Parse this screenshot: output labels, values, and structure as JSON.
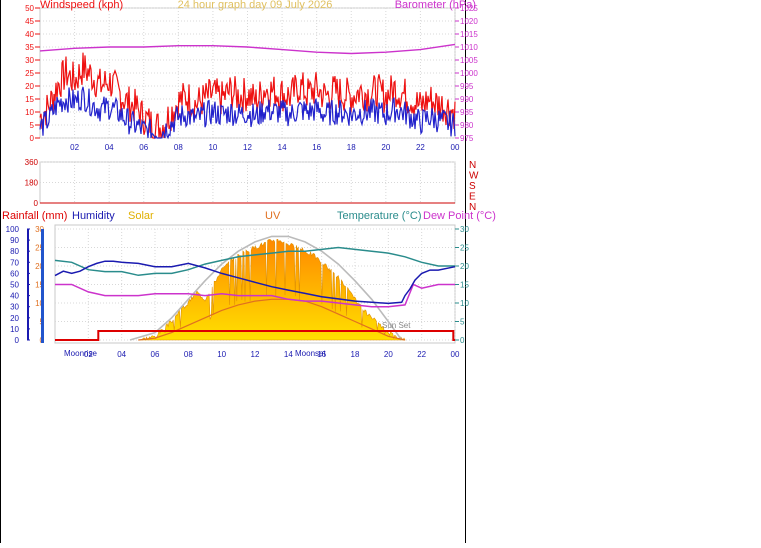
{
  "colors": {
    "wind": "#ee1111",
    "gust_avg": "#2222cc",
    "baro": "#cc33cc",
    "wind_dir_axis": "#cc0000",
    "rain": "#dd0000",
    "humidity": "#1a1ab0",
    "solar": "#e0b000",
    "uv": "#e07020",
    "temperature": "#2a8c8c",
    "dew_point": "#cc33cc",
    "grid": "#d8d8d8",
    "solar_fill_top": "#ff8800",
    "solar_fill_bottom": "#ffe000",
    "theoretical_solar": "#bbbbbb",
    "sun_bar": "#dd0000"
  },
  "chart_data": [
    {
      "type": "line",
      "panel": "wind-barometer",
      "title": "24 hour graph day 09 July 2026",
      "left_axis_label": "Windspeed (kph)",
      "right_axis_label": "Barometer (hPa)",
      "x_ticks": [
        "02",
        "04",
        "06",
        "08",
        "10",
        "12",
        "14",
        "16",
        "18",
        "20",
        "22",
        "00"
      ],
      "x_range": [
        0,
        24
      ],
      "left_ticks": [
        "0",
        "5",
        "10",
        "15",
        "20",
        "25",
        "30",
        "35",
        "40",
        "45",
        "50"
      ],
      "left_range": [
        0,
        50
      ],
      "right_ticks": [
        "975",
        "980",
        "985",
        "990",
        "995",
        "1000",
        "1005",
        "1010",
        "1015",
        "1020",
        "1025"
      ],
      "right_range": [
        975,
        1025
      ],
      "series": [
        {
          "key": "wind_gust",
          "hours": [
            0,
            0.5,
            1,
            1.5,
            2,
            2.5,
            3,
            3.5,
            4,
            4.5,
            5,
            5.5,
            6,
            6.5,
            7,
            7.5,
            8,
            8.5,
            9,
            9.5,
            10,
            10.5,
            11,
            11.5,
            12,
            12.5,
            13,
            13.5,
            14,
            14.5,
            15,
            15.5,
            16,
            16.5,
            17,
            17.5,
            18,
            18.5,
            19,
            19.5,
            20,
            20.5,
            21,
            21.5,
            22,
            22.5,
            23,
            23.5,
            24
          ],
          "values": [
            8,
            12,
            20,
            25,
            22,
            27,
            24,
            20,
            22,
            18,
            14,
            12,
            8,
            5,
            4,
            9,
            14,
            16,
            13,
            15,
            17,
            15,
            18,
            16,
            17,
            14,
            19,
            18,
            17,
            16,
            20,
            17,
            19,
            16,
            18,
            17,
            16,
            18,
            17,
            18,
            16,
            19,
            17,
            15,
            12,
            15,
            13,
            12,
            10
          ]
        },
        {
          "key": "wind_avg",
          "hours": [
            0,
            0.5,
            1,
            1.5,
            2,
            2.5,
            3,
            3.5,
            4,
            4.5,
            5,
            5.5,
            6,
            6.5,
            7,
            7.5,
            8,
            8.5,
            9,
            9.5,
            10,
            10.5,
            11,
            11.5,
            12,
            12.5,
            13,
            13.5,
            14,
            14.5,
            15,
            15.5,
            16,
            16.5,
            17,
            17.5,
            18,
            18.5,
            19,
            19.5,
            20,
            20.5,
            21,
            21.5,
            22,
            22.5,
            23,
            23.5,
            24
          ],
          "values": [
            4,
            7,
            13,
            15,
            14,
            16,
            13,
            11,
            12,
            10,
            7,
            5,
            3,
            2,
            2,
            5,
            8,
            9,
            7,
            9,
            10,
            9,
            10,
            9,
            10,
            8,
            11,
            10,
            10,
            9,
            11,
            10,
            11,
            9,
            10,
            10,
            9,
            10,
            10,
            10,
            9,
            11,
            10,
            8,
            6,
            8,
            7,
            6,
            5
          ]
        },
        {
          "key": "barometer",
          "hours": [
            0,
            2,
            4,
            6,
            8,
            10,
            12,
            14,
            16,
            18,
            20,
            22,
            24
          ],
          "values": [
            1008.5,
            1009.5,
            1010,
            1010,
            1010.5,
            1010.5,
            1010,
            1009,
            1008,
            1007.5,
            1008,
            1009,
            1011
          ]
        }
      ]
    },
    {
      "type": "scatter",
      "panel": "wind-direction",
      "left_ticks": [
        "360",
        "180",
        "0"
      ],
      "right_letters": [
        "N",
        "W",
        "S",
        "E",
        "N"
      ],
      "y_range": [
        0,
        360
      ],
      "points": []
    },
    {
      "type": "line",
      "panel": "temp-humidity-solar",
      "labels": {
        "rain": "Rainfall (mm)",
        "humidity": "Humidity",
        "solar": "Solar",
        "uv": "UV",
        "temperature": "Temperature (°C)",
        "dew_point": "Dew Point (°C)"
      },
      "x_ticks": [
        "02",
        "04",
        "06",
        "08",
        "10",
        "12",
        "14",
        "16",
        "18",
        "20",
        "22",
        "00"
      ],
      "x_range": [
        0,
        24
      ],
      "humidity_ticks": [
        "0",
        "10",
        "20",
        "30",
        "40",
        "50",
        "60",
        "70",
        "80",
        "90",
        "100"
      ],
      "humidity_range": [
        0,
        100
      ],
      "uv_ticks": [
        "0",
        "5",
        "10",
        "15",
        "20",
        "25",
        "30"
      ],
      "uv_range": [
        0,
        30
      ],
      "temp_ticks": [
        "0",
        "5",
        "10",
        "15",
        "20",
        "25",
        "30"
      ],
      "temp_range": [
        0,
        30
      ],
      "annotations": {
        "moonrise": "Moonrise",
        "moonset": "Moonset",
        "sunset": "Sun Set"
      },
      "sun_up_hours": [
        2.6,
        23.9
      ],
      "series": [
        {
          "key": "humidity",
          "hours": [
            0,
            0.5,
            1,
            1.5,
            2,
            2.5,
            3,
            3.5,
            4,
            5,
            6,
            7,
            8,
            9,
            10,
            11,
            12,
            13,
            14,
            15,
            16,
            17,
            18,
            19,
            20,
            20.8,
            21,
            21.3,
            21.6,
            22,
            22.5,
            23,
            24
          ],
          "values": [
            58,
            62,
            60,
            62,
            66,
            69,
            71,
            71,
            70,
            69,
            66,
            66,
            69,
            65,
            60,
            56,
            52,
            48,
            45,
            42,
            39,
            37,
            35,
            34,
            33,
            34,
            40,
            46,
            54,
            60,
            63,
            63,
            66
          ]
        },
        {
          "key": "temperature",
          "hours": [
            0,
            1,
            2,
            3,
            4,
            5,
            6,
            7,
            8,
            9,
            10,
            11,
            12,
            13,
            14,
            15,
            16,
            17,
            18,
            19,
            20,
            21,
            22,
            23,
            24
          ],
          "values": [
            21.5,
            21,
            19,
            18.5,
            18.5,
            17.5,
            18,
            18,
            19,
            20.5,
            21.5,
            22.5,
            23,
            23.5,
            24,
            24,
            24.5,
            25,
            24.5,
            24,
            23.5,
            22.5,
            21,
            20,
            20
          ]
        },
        {
          "key": "dew_point",
          "hours": [
            0,
            1,
            2,
            3,
            4,
            5,
            6,
            7,
            8,
            9,
            10,
            11,
            12,
            13,
            14,
            15,
            16,
            17,
            18,
            19,
            20,
            21,
            21.5,
            22,
            23,
            24
          ],
          "values": [
            15,
            15,
            13,
            12,
            12,
            12,
            12.5,
            12.5,
            12.5,
            12,
            12.5,
            12,
            12,
            12,
            11,
            10.5,
            10.5,
            10,
            9.5,
            9,
            9,
            9.5,
            15,
            14,
            15,
            15
          ]
        },
        {
          "key": "solar_theoretical",
          "hours": [
            4.5,
            6,
            7,
            8,
            9,
            10,
            11,
            12,
            13,
            14,
            15,
            16,
            17,
            18,
            19,
            20,
            20.8
          ],
          "values": [
            0,
            2,
            6,
            11,
            16,
            20.5,
            24,
            26.5,
            28,
            28,
            26.5,
            24,
            20.5,
            16,
            11,
            5,
            0
          ]
        },
        {
          "key": "solar",
          "hours": [
            5,
            6,
            6.5,
            7,
            7.5,
            8,
            8.5,
            9,
            9.5,
            10,
            10.5,
            11,
            11.5,
            12,
            12.5,
            13,
            13.5,
            14,
            14.5,
            15,
            15.5,
            16,
            16.5,
            17,
            17.5,
            18,
            18.5,
            19,
            19.5,
            20,
            20.5,
            21
          ],
          "values": [
            0,
            1,
            3,
            5,
            8,
            10,
            13,
            11,
            15,
            19,
            21,
            23,
            24,
            25,
            26,
            27,
            27,
            26,
            25,
            24,
            23,
            21,
            19,
            17,
            14,
            11,
            8,
            6,
            4,
            2,
            1,
            0
          ]
        },
        {
          "key": "uv",
          "hours": [
            5,
            6,
            7,
            8,
            9,
            10,
            11,
            12,
            13,
            14,
            15,
            16,
            17,
            18,
            19,
            20,
            21
          ],
          "values": [
            0,
            0.5,
            2,
            4,
            6,
            8,
            9.5,
            10.5,
            11,
            11,
            10.5,
            9,
            7,
            5,
            3,
            1,
            0
          ]
        }
      ]
    }
  ]
}
